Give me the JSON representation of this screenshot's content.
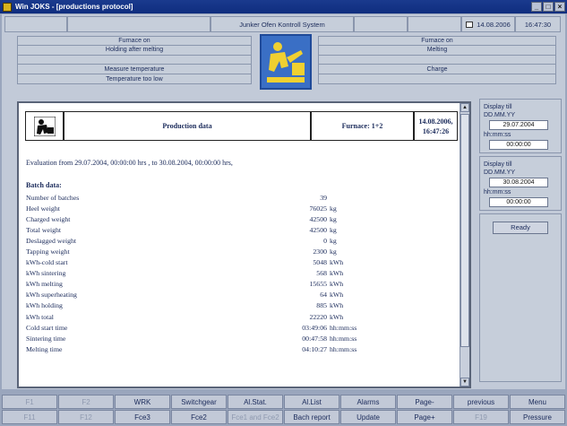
{
  "window": {
    "title": "Win JOKS - [productions protocol]",
    "min": "_",
    "max": "□",
    "close": "×"
  },
  "header": {
    "system": "Junker Ofen Kontroll System",
    "date": "14.08.2006",
    "time": "16:47:30"
  },
  "status_left": [
    "Furnace on",
    "Holding after melting",
    "",
    "Measure temperature",
    "Temperature too low"
  ],
  "status_right": [
    "Furnace on",
    "Melting",
    "",
    "Charge",
    ""
  ],
  "report": {
    "title": "Production data",
    "furnace": "Furnace: 1+2",
    "date": "14.08.2006,",
    "time": "16:47:26",
    "evaluation": "Evaluation from 29.07.2004, 00:00:00 hrs , to 30.08.2004, 00:00:00 hrs,",
    "batch_title": "Batch data:",
    "rows": [
      {
        "label": "Number of batches",
        "value": "39",
        "unit": ""
      },
      {
        "label": "Heel weight",
        "value": "76025",
        "unit": "kg"
      },
      {
        "label": "Charged weight",
        "value": "42500",
        "unit": "kg"
      },
      {
        "label": "Total weight",
        "value": "42500",
        "unit": "kg"
      },
      {
        "label": "Deslagged weight",
        "value": "0",
        "unit": "kg"
      },
      {
        "label": "Tapping weight",
        "value": "2300",
        "unit": "kg"
      },
      {
        "label": "kWh-cold start",
        "value": "5048",
        "unit": "kWh"
      },
      {
        "label": "kWh sintering",
        "value": "568",
        "unit": "kWh"
      },
      {
        "label": "kWh melting",
        "value": "15655",
        "unit": "kWh"
      },
      {
        "label": "kWh superheating",
        "value": "64",
        "unit": "kWh"
      },
      {
        "label": "kWh holding",
        "value": "885",
        "unit": "kWh"
      },
      {
        "label": "kWh total",
        "value": "22220",
        "unit": "kWh"
      },
      {
        "label": "Cold start time",
        "value": "03:49:06",
        "unit": "hh:mm:ss"
      },
      {
        "label": "Sintering time",
        "value": "00:47:58",
        "unit": "hh:mm:ss"
      },
      {
        "label": "Melting time",
        "value": "04:10:27",
        "unit": "hh:mm:ss"
      }
    ]
  },
  "right_panel": {
    "from": {
      "title": "Display till",
      "date_label": "DD.MM.YY",
      "date_value": "29.07.2004",
      "time_label": "hh:mm:ss",
      "time_value": "00:00:00"
    },
    "to": {
      "title": "Display till",
      "date_label": "DD.MM.YY",
      "date_value": "30.08.2004",
      "time_label": "hh:mm:ss",
      "time_value": "00:00:00"
    },
    "ready": "Ready"
  },
  "fkeys": [
    {
      "label": "F1",
      "dim": true
    },
    {
      "label": "F2",
      "dim": true
    },
    {
      "label": "WRK",
      "dim": false
    },
    {
      "label": "Switchgear",
      "dim": false
    },
    {
      "label": "Al.Stat.",
      "dim": false
    },
    {
      "label": "Al.List",
      "dim": false
    },
    {
      "label": "Alarms",
      "dim": false
    },
    {
      "label": "Page-",
      "dim": false
    },
    {
      "label": "previous",
      "dim": false
    },
    {
      "label": "Menu",
      "dim": false
    },
    {
      "label": "F11",
      "dim": true
    },
    {
      "label": "F12",
      "dim": true
    },
    {
      "label": "Fce3",
      "dim": false
    },
    {
      "label": "Fce2",
      "dim": false
    },
    {
      "label": "Fce1 and Fce2",
      "dim": true
    },
    {
      "label": "Bach report",
      "dim": false
    },
    {
      "label": "Update",
      "dim": false
    },
    {
      "label": "Page+",
      "dim": false
    },
    {
      "label": "F19",
      "dim": true
    },
    {
      "label": "Pressure",
      "dim": false
    }
  ]
}
